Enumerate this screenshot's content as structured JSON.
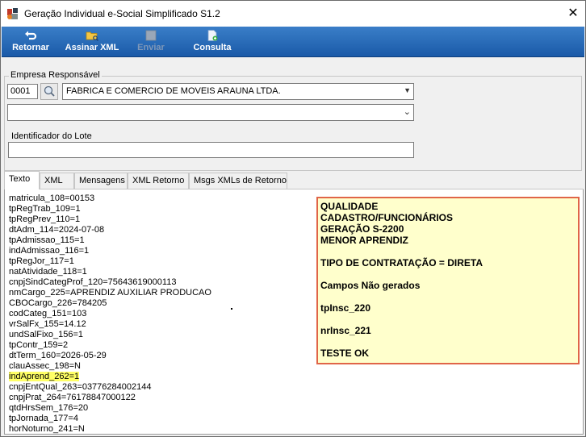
{
  "window": {
    "title": "Geração Individual e-Social Simplificado S1.2",
    "close_glyph": "✕",
    "app_icon": "app-logo-icon"
  },
  "toolbar": {
    "buttons": [
      {
        "label": "Retornar",
        "icon": "return-arrow-icon",
        "enabled": true
      },
      {
        "label": "Assinar XML",
        "icon": "sign-folder-icon",
        "enabled": true
      },
      {
        "label": "Enviar",
        "icon": "send-icon",
        "enabled": false
      },
      {
        "label": "Consulta",
        "icon": "query-document-icon",
        "enabled": true
      }
    ]
  },
  "empresa": {
    "legend": "Empresa Responsável",
    "code": "0001",
    "name": "FABRICA E COMERCIO DE MOVEIS ARAUNA LTDA.",
    "second_select": ""
  },
  "lote": {
    "label": "Identificador do Lote",
    "value": ""
  },
  "tabs": [
    {
      "label": "Texto",
      "active": true
    },
    {
      "label": "XML",
      "active": false
    },
    {
      "label": "Mensagens",
      "active": false
    },
    {
      "label": "XML Retorno",
      "active": false
    },
    {
      "label": "Msgs XMLs de Retorno",
      "active": false
    }
  ],
  "text_lines": [
    "matricula_108=00153",
    "tpRegTrab_109=1",
    "tpRegPrev_110=1",
    "dtAdm_114=2024-07-08",
    "tpAdmissao_115=1",
    "indAdmissao_116=1",
    "tpRegJor_117=1",
    "natAtividade_118=1",
    "cnpjSindCategProf_120=75643619000113",
    "nmCargo_225=APRENDIZ AUXILIAR PRODUCAO",
    "CBOCargo_226=784205",
    "codCateg_151=103",
    "vrSalFx_155=14.12",
    "undSalFixo_156=1",
    "tpContr_159=2",
    "dtTerm_160=2026-05-29",
    "clauAssec_198=N",
    "indAprend_262=1",
    "cnpjEntQual_263=03776284002144",
    "cnpjPrat_264=76178847000122",
    "qtdHrsSem_176=20",
    "tpJornada_177=4",
    "horNoturno_241=N"
  ],
  "highlighted_line": "indAprend_262=1",
  "note": {
    "border_color": "#e06548",
    "background": "#ffffcc",
    "lines": [
      "QUALIDADE",
      "CADASTRO/FUNCIONÁRIOS",
      "GERAÇÃO S-2200",
      "MENOR APRENDIZ",
      "",
      "TIPO DE CONTRATAÇÃO = DIRETA",
      "",
      "Campos Não gerados",
      "",
      "tpInsc_220",
      "",
      "nrInsc_221",
      "",
      "TESTE OK"
    ]
  }
}
